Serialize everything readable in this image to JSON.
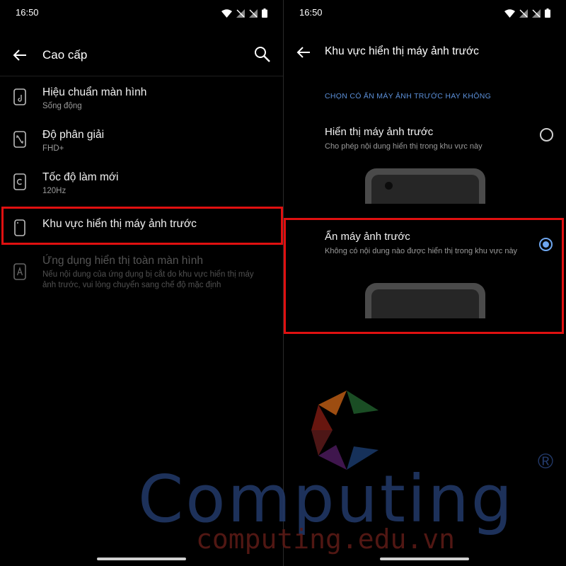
{
  "left": {
    "status": {
      "time": "16:50"
    },
    "appbar": {
      "title": "Cao cấp"
    },
    "items": [
      {
        "title": "Hiệu chuẩn màn hình",
        "subtitle": "Sống động",
        "icon": "display-calibration-icon"
      },
      {
        "title": "Độ phân giải",
        "subtitle": "FHD+",
        "icon": "resolution-icon"
      },
      {
        "title": "Tốc độ làm mới",
        "subtitle": "120Hz",
        "icon": "refresh-rate-icon"
      },
      {
        "title": "Khu vực hiển thị máy ảnh trước",
        "subtitle": "",
        "icon": "front-camera-area-icon"
      },
      {
        "title": "Ứng dụng hiển thị toàn màn hình",
        "subtitle": "Nếu nội dung của ứng dụng bị cắt do khu vực hiển thị máy ảnh trước, vui lòng chuyển sang chế độ mặc định",
        "icon": "fullscreen-app-icon"
      }
    ]
  },
  "right": {
    "status": {
      "time": "16:50"
    },
    "appbar": {
      "title": "Khu vực hiển thị máy ảnh trước"
    },
    "section_label": "CHỌN CÓ ẨN MÁY ẢNH TRƯỚC HAY KHÔNG",
    "options": [
      {
        "title": "Hiển thị máy ảnh trước",
        "subtitle": "Cho phép nội dung hiển thị trong khu vực này",
        "selected": false
      },
      {
        "title": "Ẩn máy ảnh trước",
        "subtitle": "Không có nội dung nào được hiển thị trong khu vực này",
        "selected": true
      }
    ]
  },
  "watermark": {
    "brand": "Computing",
    "url": "computing.edu.vn",
    "registered": "®"
  },
  "colors": {
    "accent": "#6ea6ef",
    "highlight": "#e01010",
    "section_label": "#5b8fd8",
    "background": "#000000"
  }
}
